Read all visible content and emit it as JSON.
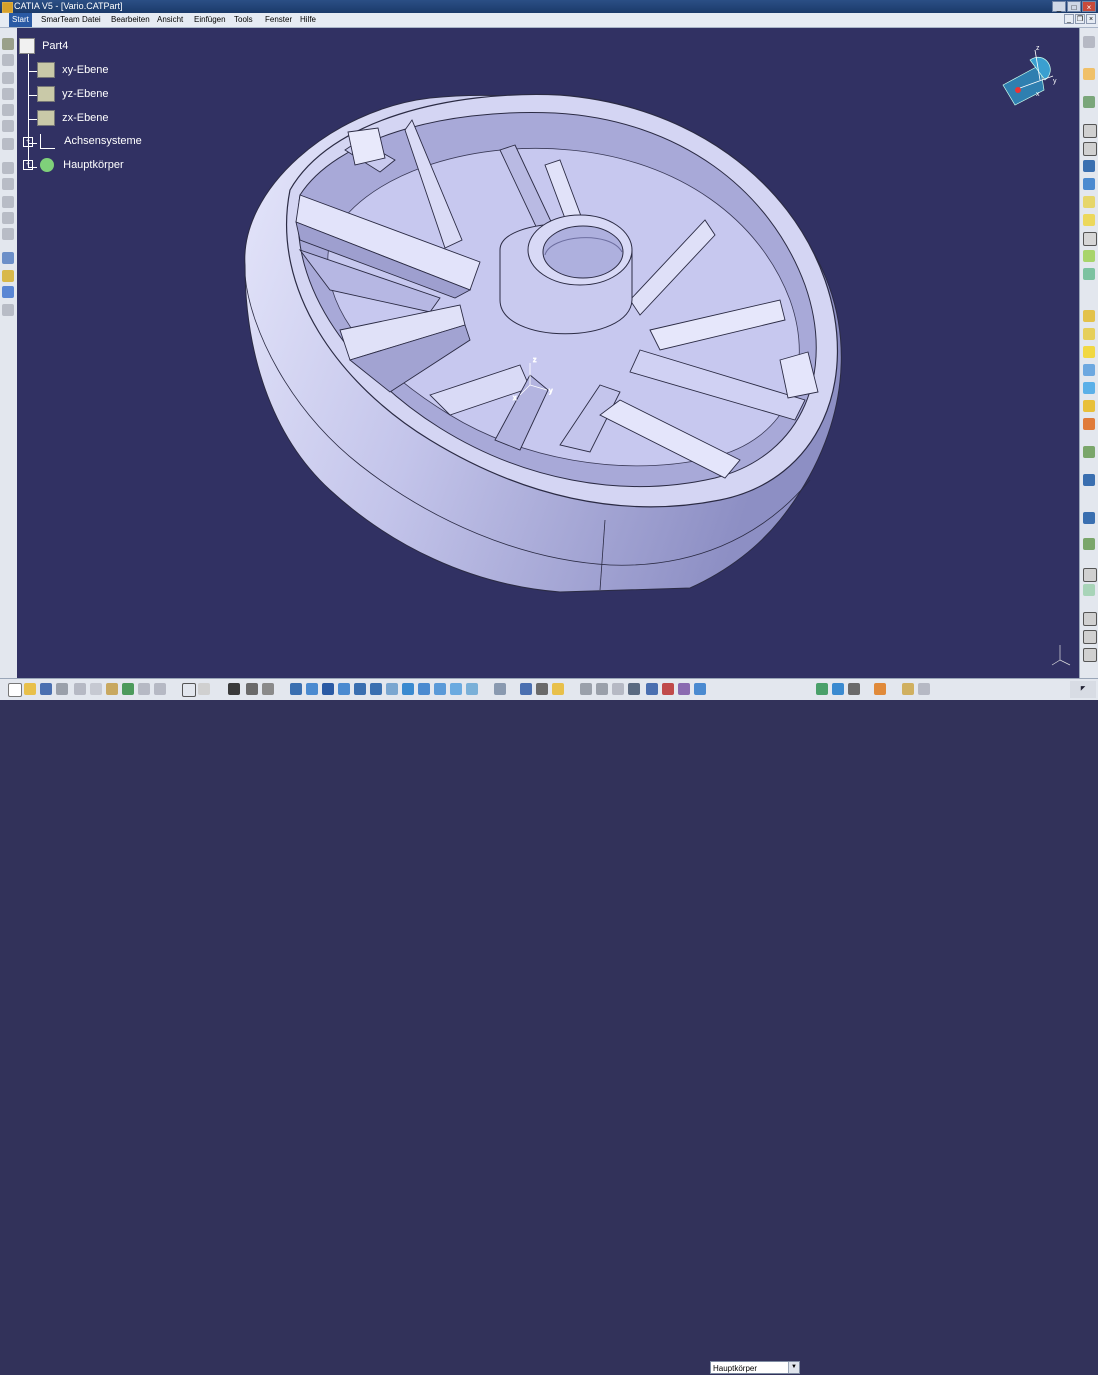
{
  "window": {
    "title": "CATIA V5 - [Vario.CATPart]"
  },
  "menu": {
    "items": [
      "Start",
      "SmarTeam",
      "Datei",
      "Bearbeiten",
      "Ansicht",
      "Einfügen",
      "Tools",
      "Fenster",
      "Hilfe"
    ]
  },
  "tree": {
    "root": "Part4",
    "children": [
      "xy-Ebene",
      "yz-Ebene",
      "zx-Ebene",
      "Achsensysteme",
      "Hauptkörper"
    ]
  },
  "compass": {
    "axes": [
      "x",
      "y",
      "z"
    ]
  },
  "origin_axes": {
    "axes": [
      "x",
      "y",
      "z"
    ]
  },
  "toolbar": {
    "current_body": "Hauptkörper"
  },
  "colors": {
    "background": "#313163",
    "part": "#cfd0f2",
    "tree_text": "#ffffff"
  },
  "icons": [
    "new-file-icon",
    "open-file-icon",
    "save-icon",
    "print-icon",
    "cut-icon",
    "copy-icon",
    "paste-icon",
    "undo-icon",
    "redo-icon",
    "help-icon",
    "formula-icon",
    "comment-icon",
    "fly-icon",
    "pan-icon",
    "rotate-icon",
    "zoom-in-icon",
    "zoom-out-icon",
    "normal-view-icon",
    "iso-view-icon",
    "shading-icon",
    "hide-show-icon",
    "swap-icon",
    "measure-icon",
    "material-icon",
    "render-icon"
  ]
}
